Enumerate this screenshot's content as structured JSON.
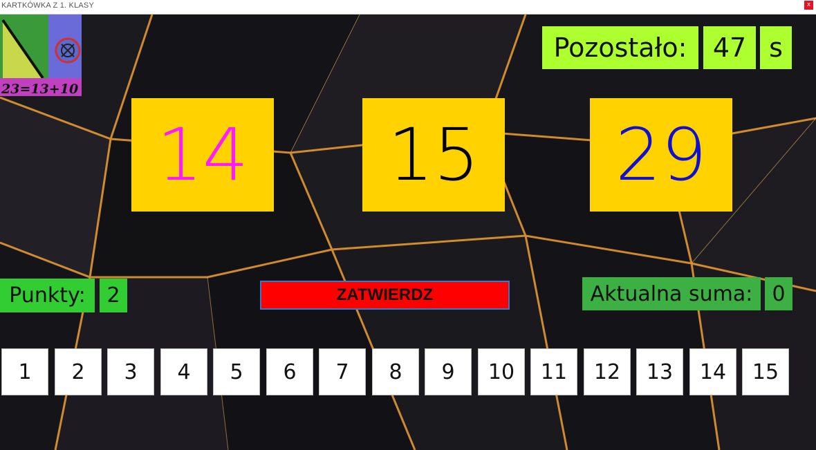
{
  "window": {
    "title": "KARTKÓWKA Z 1. KLASY",
    "close_glyph": "x"
  },
  "logo": {
    "caption": "23=13+10"
  },
  "timer": {
    "label": "Pozostało:",
    "value": "47",
    "unit": "s"
  },
  "numbers": [
    {
      "value": "14",
      "color": "#ff1aff"
    },
    {
      "value": "15",
      "color": "#000000"
    },
    {
      "value": "29",
      "color": "#1010d0"
    }
  ],
  "score": {
    "label": "Punkty:",
    "value": "2"
  },
  "submit": {
    "label": "ZATWIERDZ"
  },
  "current_sum": {
    "label": "Aktualna suma:",
    "value": "0"
  },
  "choices": [
    "1",
    "2",
    "3",
    "4",
    "5",
    "6",
    "7",
    "8",
    "9",
    "10",
    "11",
    "12",
    "13",
    "14",
    "15"
  ],
  "colors": {
    "timer_bg": "#adff2f",
    "card_bg": "#ffd200",
    "score_bg": "#32cd32",
    "submit_bg": "#ff0000",
    "background_lines": "#f0a030"
  }
}
